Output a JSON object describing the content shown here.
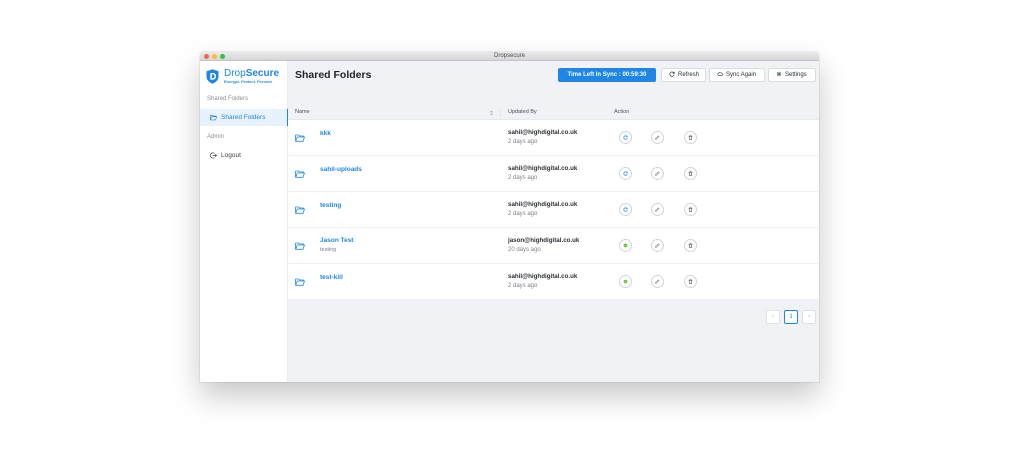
{
  "window": {
    "title": "Dropsecure"
  },
  "brand": {
    "name_light": "Drop",
    "name_bold": "Secure",
    "tagline": "Encrypt. Protect. Prevent",
    "color": "#1f86e6"
  },
  "sidebar": {
    "sections": [
      {
        "title": "Shared Folders",
        "items": [
          {
            "label": "Shared Folders",
            "icon": "folder-icon",
            "active": true
          }
        ]
      },
      {
        "title": "Admin",
        "items": [
          {
            "label": "Logout",
            "icon": "logout-icon",
            "active": false
          }
        ]
      }
    ]
  },
  "header": {
    "title": "Shared Folders",
    "timer_label": "Time Left In Sync :",
    "timer_value": "00:59:30",
    "refresh_label": "Refresh",
    "sync_label": "Sync Again",
    "settings_label": "Settings"
  },
  "table": {
    "columns": {
      "name": "Name",
      "updated_by": "Updated By",
      "action": "Action"
    },
    "rows": [
      {
        "name": "kkk",
        "subtitle": "",
        "email": "sahil@highdigital.co.uk",
        "time": "2 days ago",
        "status": "syncing"
      },
      {
        "name": "sahil-uploads",
        "subtitle": "",
        "email": "sahil@highdigital.co.uk",
        "time": "2 days ago",
        "status": "syncing"
      },
      {
        "name": "testing",
        "subtitle": "",
        "email": "sahil@highdigital.co.uk",
        "time": "2 days ago",
        "status": "syncing"
      },
      {
        "name": "Jason Test",
        "subtitle": "testing",
        "email": "jason@highdigital.co.uk",
        "time": "20 days ago",
        "status": "synced"
      },
      {
        "name": "test-kill",
        "subtitle": "",
        "email": "sahil@highdigital.co.uk",
        "time": "2 days ago",
        "status": "synced"
      }
    ]
  },
  "pagination": {
    "current_page": "1",
    "prev": "‹",
    "next": "›"
  },
  "colors": {
    "accent": "#1f86e6",
    "sync_green": "#52c41a",
    "background": "#f1f2f5"
  }
}
